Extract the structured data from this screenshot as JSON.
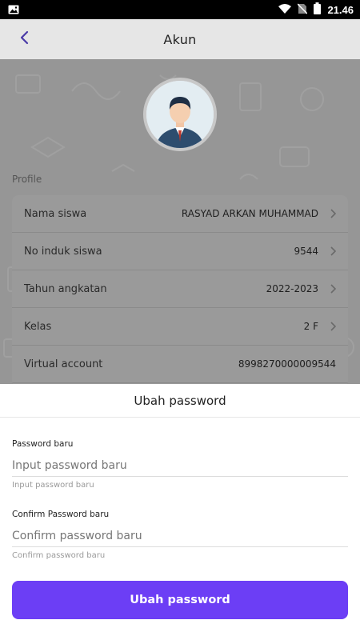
{
  "status_bar": {
    "time": "21.46",
    "icons": [
      "image-icon",
      "wifi-icon",
      "no-sim-icon",
      "battery-icon"
    ]
  },
  "app_bar": {
    "title": "Akun",
    "back_icon": "chevron-left-icon"
  },
  "colors": {
    "accent": "#6c3ef5",
    "back_icon": "#4a3aa8"
  },
  "profile": {
    "section_label": "Profile",
    "avatar_icon": "businessman-avatar",
    "rows": [
      {
        "label": "Nama siswa",
        "value": "RASYAD ARKAN MUHAMMAD",
        "chevron": true
      },
      {
        "label": "No induk siswa",
        "value": "9544",
        "chevron": true
      },
      {
        "label": "Tahun angkatan",
        "value": "2022-2023",
        "chevron": true
      },
      {
        "label": "Kelas",
        "value": "2 F",
        "chevron": true
      },
      {
        "label": "Virtual account",
        "value": "8998270000009544",
        "chevron": false
      }
    ]
  },
  "sheet": {
    "title": "Ubah password",
    "new_password": {
      "label": "Password baru",
      "placeholder": "Input password baru",
      "helper": "Input password baru"
    },
    "confirm_password": {
      "label": "Confirm Password baru",
      "placeholder": "Confirm password baru",
      "helper": "Confirm password baru"
    },
    "submit_label": "Ubah password"
  }
}
